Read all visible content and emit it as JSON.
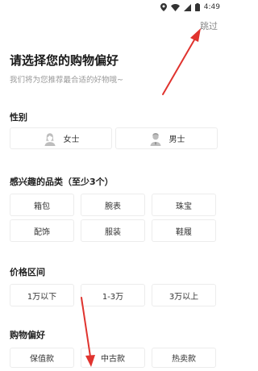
{
  "status_bar": {
    "time": "4:49"
  },
  "header": {
    "skip_label": "跳过",
    "title": "请选择您的购物偏好",
    "subtitle": "我们将为您推荐最合适的好物哦~"
  },
  "gender": {
    "title": "性别",
    "options": [
      {
        "label": "女士",
        "icon": "female-avatar-icon"
      },
      {
        "label": "男士",
        "icon": "male-avatar-icon"
      }
    ]
  },
  "categories": {
    "title": "感兴趣的品类（至少3个）",
    "options": [
      "箱包",
      "腕表",
      "珠宝",
      "配饰",
      "服装",
      "鞋履"
    ]
  },
  "price": {
    "title": "价格区间",
    "options": [
      "1万以下",
      "1-3万",
      "3万以上"
    ]
  },
  "preference": {
    "title": "购物偏好",
    "options": [
      "保值款",
      "中古款",
      "热卖款"
    ]
  },
  "colors": {
    "annotation_arrow": "#e0332e"
  }
}
